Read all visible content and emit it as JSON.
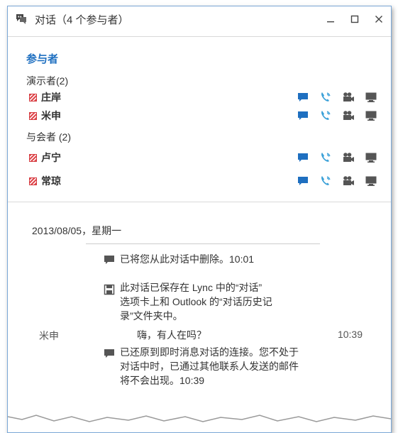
{
  "window": {
    "title": "对话（4 个参与者）"
  },
  "participants": {
    "section_title": "参与者",
    "groups": [
      {
        "label": "演示者(2)",
        "people": [
          {
            "name": "庄岸"
          },
          {
            "name": "米申"
          }
        ]
      },
      {
        "label": "与会者 (2)",
        "people": [
          {
            "name": "卢宁"
          },
          {
            "name": "常琼"
          }
        ]
      }
    ]
  },
  "conversation": {
    "date": "2013/08/05，星期一",
    "messages": [
      {
        "text": "已将您从此对话中删除。10:01"
      },
      {
        "lines": [
          "此对话已保存在 Lync 中的“对话”",
          "选项卡上和 Outlook 的“对话历史记",
          "录”文件夹中。"
        ]
      },
      {
        "sender": "米申",
        "text": "嗨，有人在吗？",
        "time": "10:39"
      },
      {
        "lines": [
          "已还原到即时消息对话的连接。您不处于",
          "对话中时，已通过其他联系人发送的邮件",
          "将不会出现。10:39"
        ]
      }
    ]
  },
  "colors": {
    "accent": "#1e6fc0",
    "im_icon": "#1e6fc0",
    "phone_icon": "#3aa0d8",
    "presence_busy": "#e0474c",
    "gray_icon": "#555555"
  }
}
